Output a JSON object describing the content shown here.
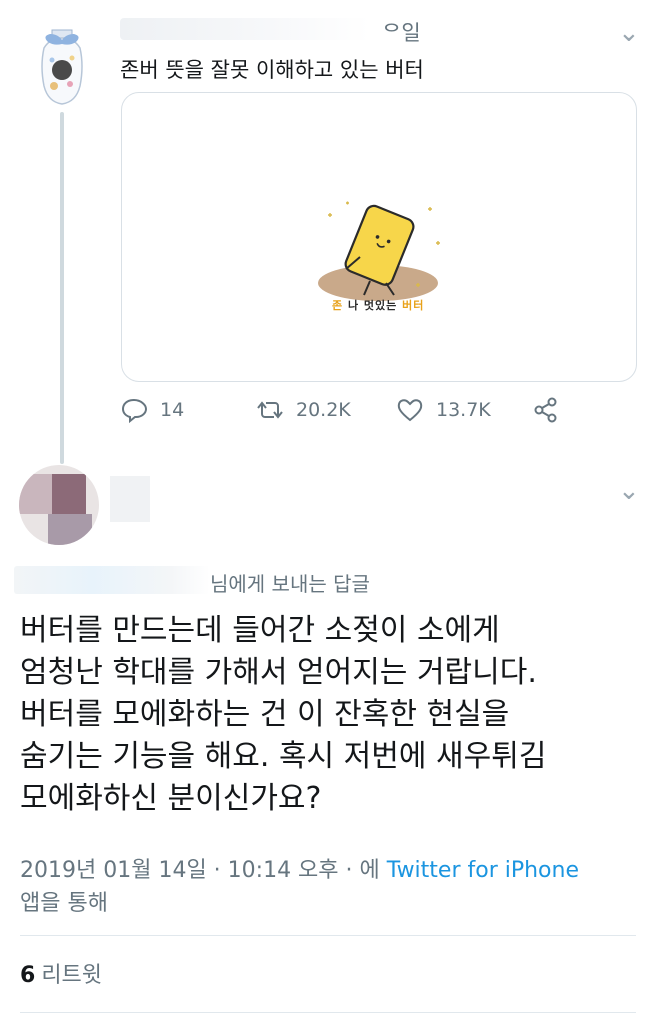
{
  "parent_tweet": {
    "date_partial": "ᄋ일",
    "text": "존버 뜻을 잘못 이해하고 있는 버터",
    "media": {
      "caption_zon": "존",
      "caption_mid": "나 멋있는",
      "caption_butter": "버터"
    },
    "actions": {
      "reply_count": "14",
      "retweet_count": "20.2K",
      "like_count": "13.7K"
    }
  },
  "main_tweet": {
    "replying_to": "님에게 보내는 답글",
    "text": "버터를 만드는데 들어간 소젖이 소에게\n엄청난 학대를 가해서 얻어지는 거랍니다.\n버터를 모에화하는 건 이 잔혹한 현실을\n숨기는 기능을 해요. 혹시 저번에 새우튀김\n모에화하신 분이신가요?",
    "timestamp": "2019년 01월 14일 · 10:14 오후 · 에",
    "source": "Twitter for iPhone",
    "source_suffix": "앱을 통해",
    "retweet_number": "6",
    "retweet_label": "리트윗"
  },
  "icons": {
    "more": "chevron-down-icon",
    "reply": "reply-icon",
    "retweet": "retweet-icon",
    "like": "heart-icon",
    "share": "share-icon"
  },
  "colors": {
    "text": "#14171a",
    "muted": "#66757f",
    "link": "#1b95e0",
    "border": "#e1e8ed",
    "butter": "#f7d64a"
  }
}
